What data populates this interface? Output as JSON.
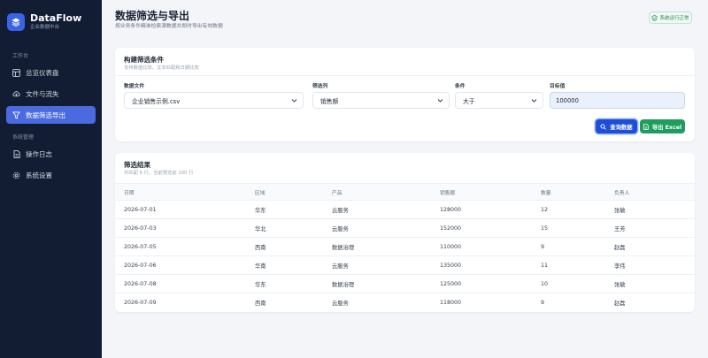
{
  "sidebar": {
    "brand_name": "DataFlow",
    "brand_sub": "企业数据中台",
    "section_workspace": "工作台",
    "section_system": "系统管理",
    "items": [
      {
        "label": "总览仪表盘",
        "icon": "dashboard-icon"
      },
      {
        "label": "文件与流失",
        "icon": "cloud-upload-icon"
      },
      {
        "label": "数据筛选导出",
        "icon": "filter-icon",
        "active": true
      },
      {
        "label": "操作日志",
        "icon": "document-icon"
      },
      {
        "label": "系统设置",
        "icon": "gear-icon"
      }
    ]
  },
  "header": {
    "title": "数据筛选与导出",
    "subtitle": "按业务条件精准检索源数据并即时导出有效数据",
    "status": "系统运行正常"
  },
  "filter": {
    "title": "构建筛选条件",
    "subtitle": "支持数值比较、文本匹配和日期比较",
    "file_label": "数据文件",
    "file_value": "企业销售示例.csv",
    "column_label": "筛选列",
    "column_value": "销售额",
    "condition_label": "条件",
    "condition_value": "大于",
    "target_label": "目标值",
    "target_value": "100000",
    "query_button": "查询数据",
    "export_button": "导出 Excel"
  },
  "results": {
    "title": "筛选结果",
    "subtitle": "共匹配 6 行，当前预览前 100 行",
    "columns": [
      "日期",
      "区域",
      "产品",
      "销售额",
      "数量",
      "负责人"
    ],
    "rows": [
      [
        "2026-07-01",
        "华东",
        "云服务",
        "128000",
        "12",
        "张敏"
      ],
      [
        "2026-07-03",
        "华北",
        "云服务",
        "152000",
        "15",
        "王芳"
      ],
      [
        "2026-07-05",
        "西南",
        "数据治理",
        "110000",
        "9",
        "赵磊"
      ],
      [
        "2026-07-06",
        "华南",
        "云服务",
        "135000",
        "11",
        "李伟"
      ],
      [
        "2026-07-08",
        "华东",
        "数据治理",
        "125000",
        "10",
        "张敏"
      ],
      [
        "2026-07-09",
        "西南",
        "云服务",
        "118000",
        "9",
        "赵磊"
      ]
    ]
  },
  "colors": {
    "sidebar_bg": "#121d33",
    "accent": "#4b6ae0",
    "query": "#1d4ed8",
    "export": "#1f9d5f",
    "ok": "#2f855a"
  }
}
